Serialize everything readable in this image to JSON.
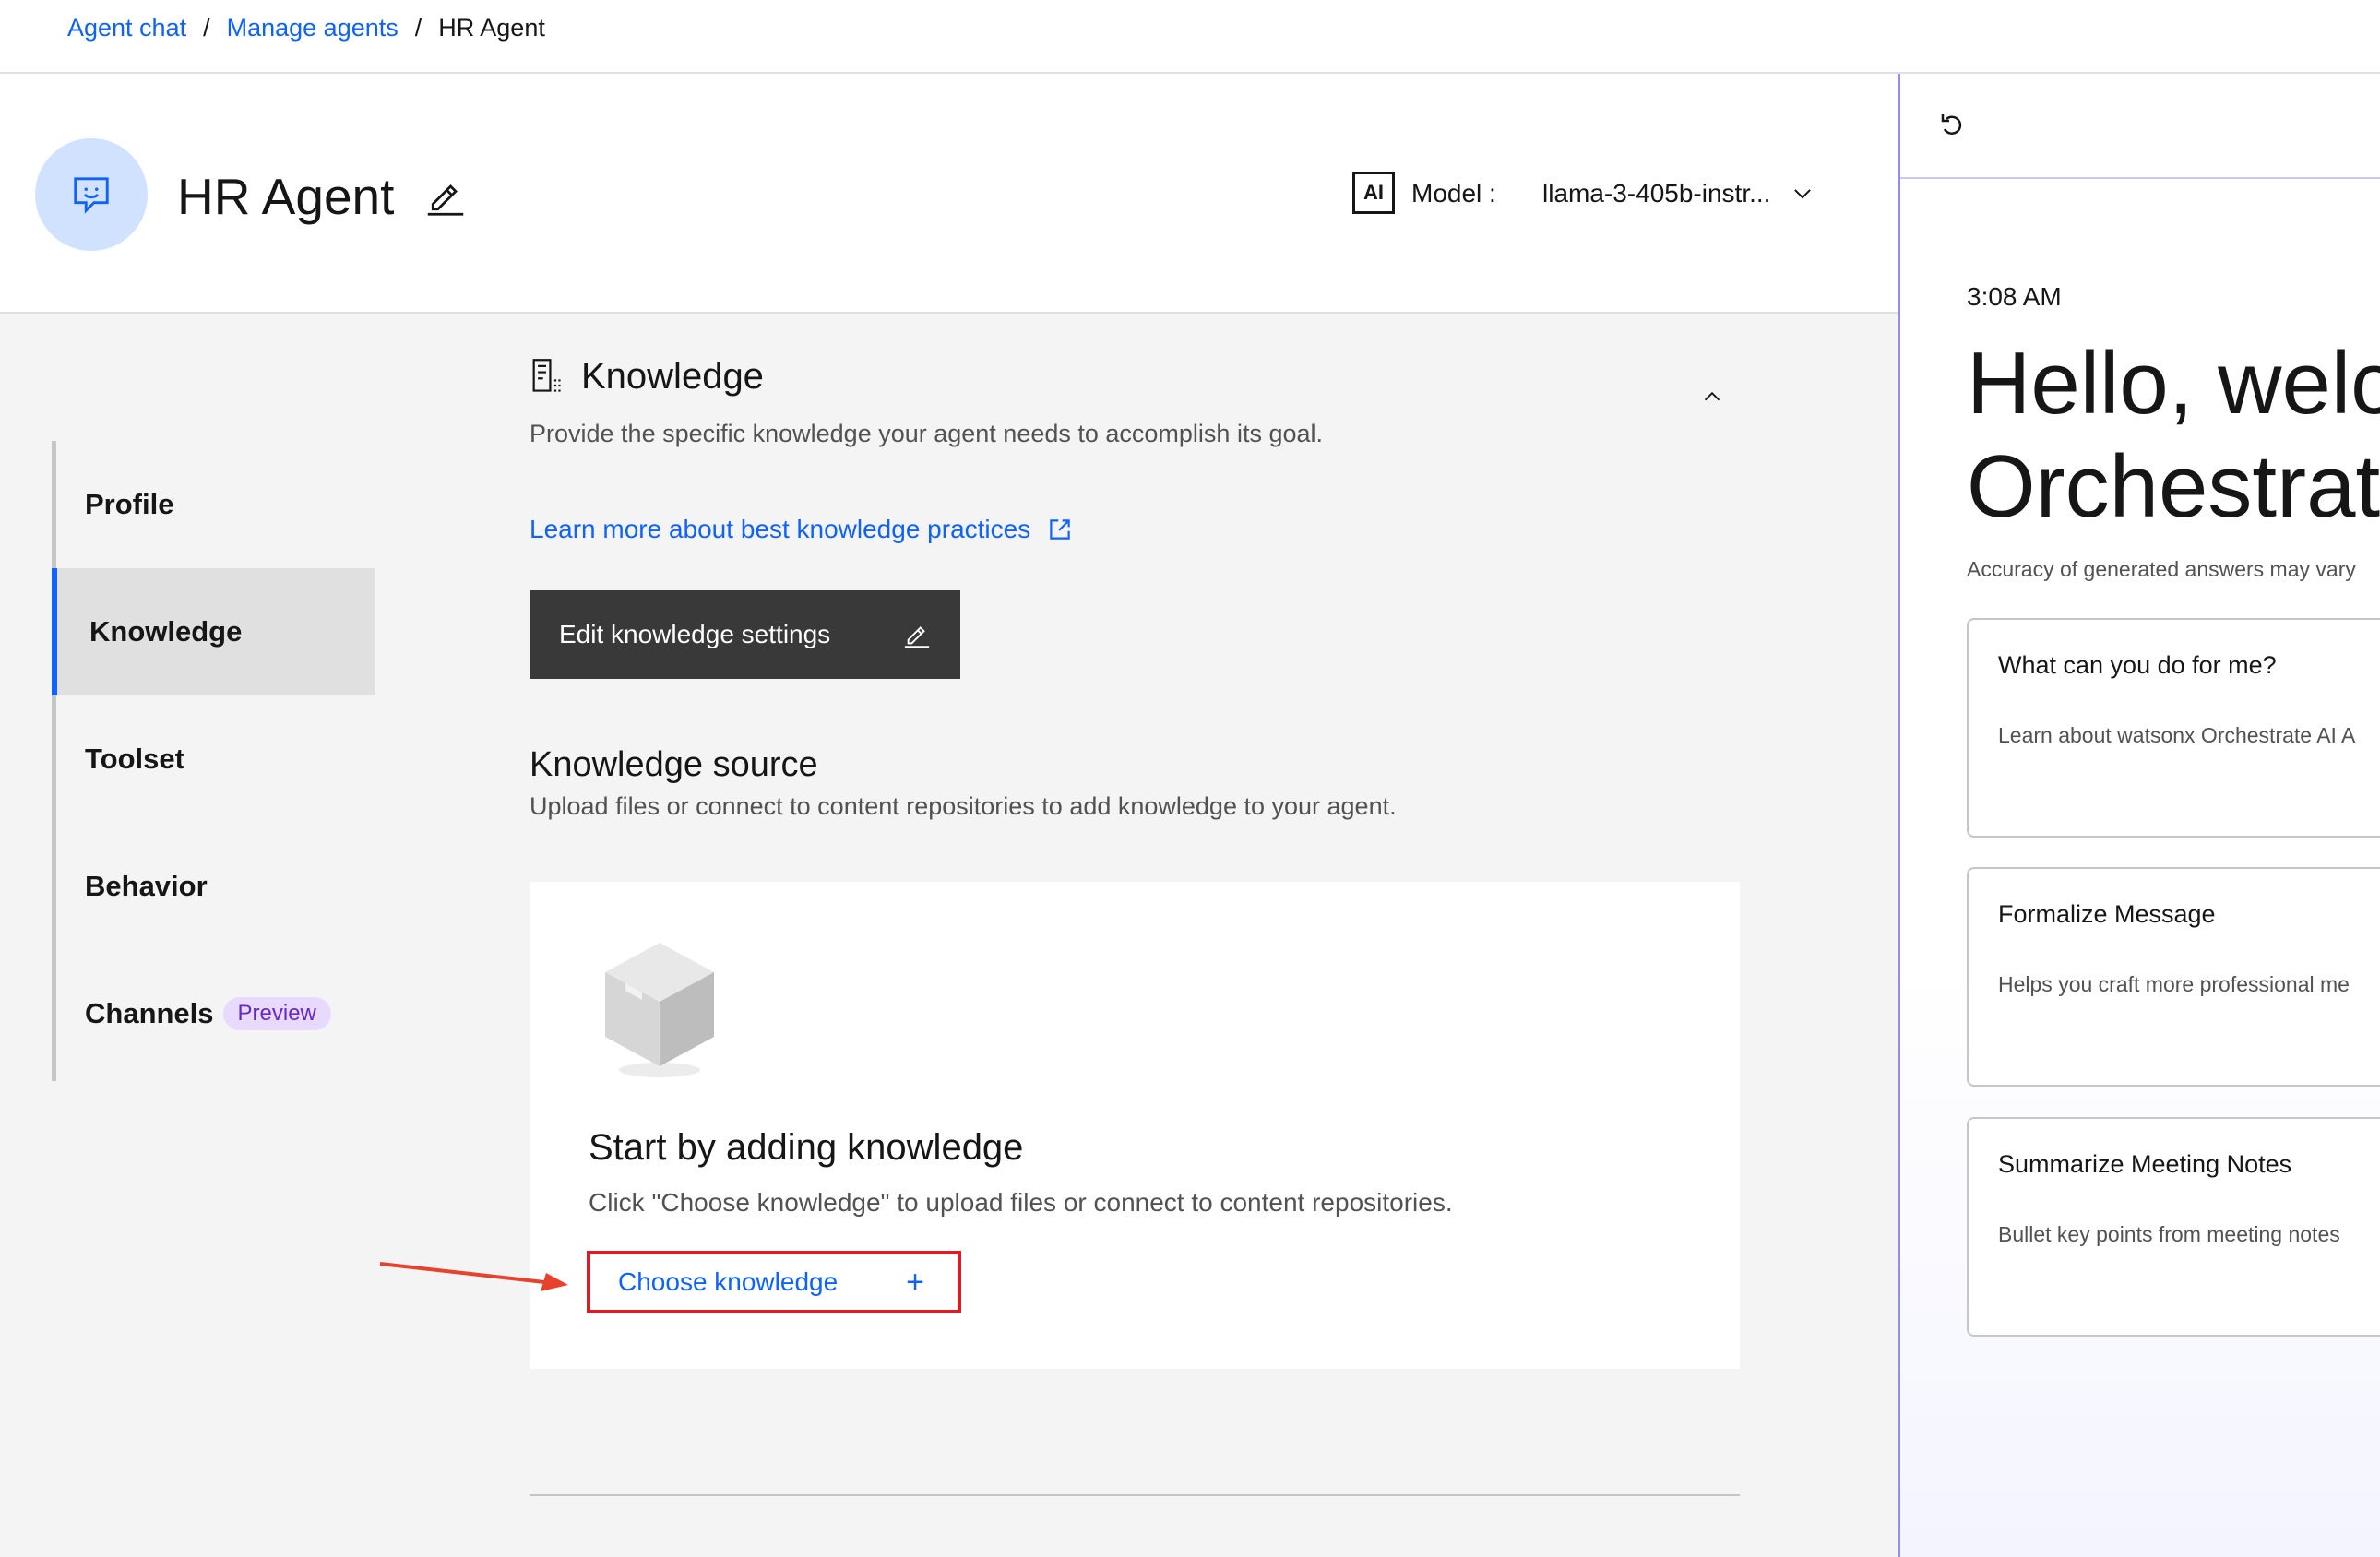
{
  "breadcrumb": {
    "items": [
      "Agent chat",
      "Manage agents"
    ],
    "current": "HR Agent",
    "separator": "/"
  },
  "header": {
    "title": "HR Agent",
    "ai_badge": "AI",
    "model_label": "Model :",
    "model_value": "llama-3-405b-instr..."
  },
  "nav": {
    "items": [
      "Profile",
      "Knowledge",
      "Toolset",
      "Behavior",
      "Channels"
    ],
    "active": "Knowledge",
    "channels_tag": "Preview"
  },
  "knowledge": {
    "title": "Knowledge",
    "description": "Provide the specific knowledge your agent needs to accomplish its goal.",
    "learn_more": "Learn more about best knowledge practices",
    "edit_button": "Edit knowledge settings",
    "source_title": "Knowledge source",
    "source_description": "Upload files or connect to content repositories to add knowledge to your agent.",
    "empty_title": "Start by adding knowledge",
    "empty_description": "Click \"Choose knowledge\" to upload files or connect to content repositories.",
    "choose_button": "Choose knowledge",
    "choose_plus": "+"
  },
  "chat": {
    "time": "3:08 AM",
    "greeting_line1": "Hello, welc",
    "greeting_line2": "Orchestrat",
    "disclaimer": "Accuracy of generated answers may vary",
    "prompts": [
      {
        "title": "What can you do for me?",
        "desc": "Learn about watsonx Orchestrate AI A"
      },
      {
        "title": "Formalize Message",
        "desc": "Helps you craft more professional me"
      },
      {
        "title": "Summarize Meeting Notes",
        "desc": "Bullet key points from meeting notes"
      }
    ]
  },
  "colors": {
    "link": "#0f62fe",
    "highlight_box": "#da1e28",
    "primary_button": "#393939",
    "avatar_bg": "#d0e2ff",
    "preview_tag_bg": "#e8daff"
  },
  "icons": {
    "avatar": "chat-bot-icon",
    "title_edit": "pencil-icon",
    "model": "chevron-down-icon",
    "knowledge": "document-list-icon",
    "collapse": "chevron-up-icon",
    "learn_more": "external-link-icon",
    "empty_state": "box-icon",
    "reset": "reset-icon"
  }
}
